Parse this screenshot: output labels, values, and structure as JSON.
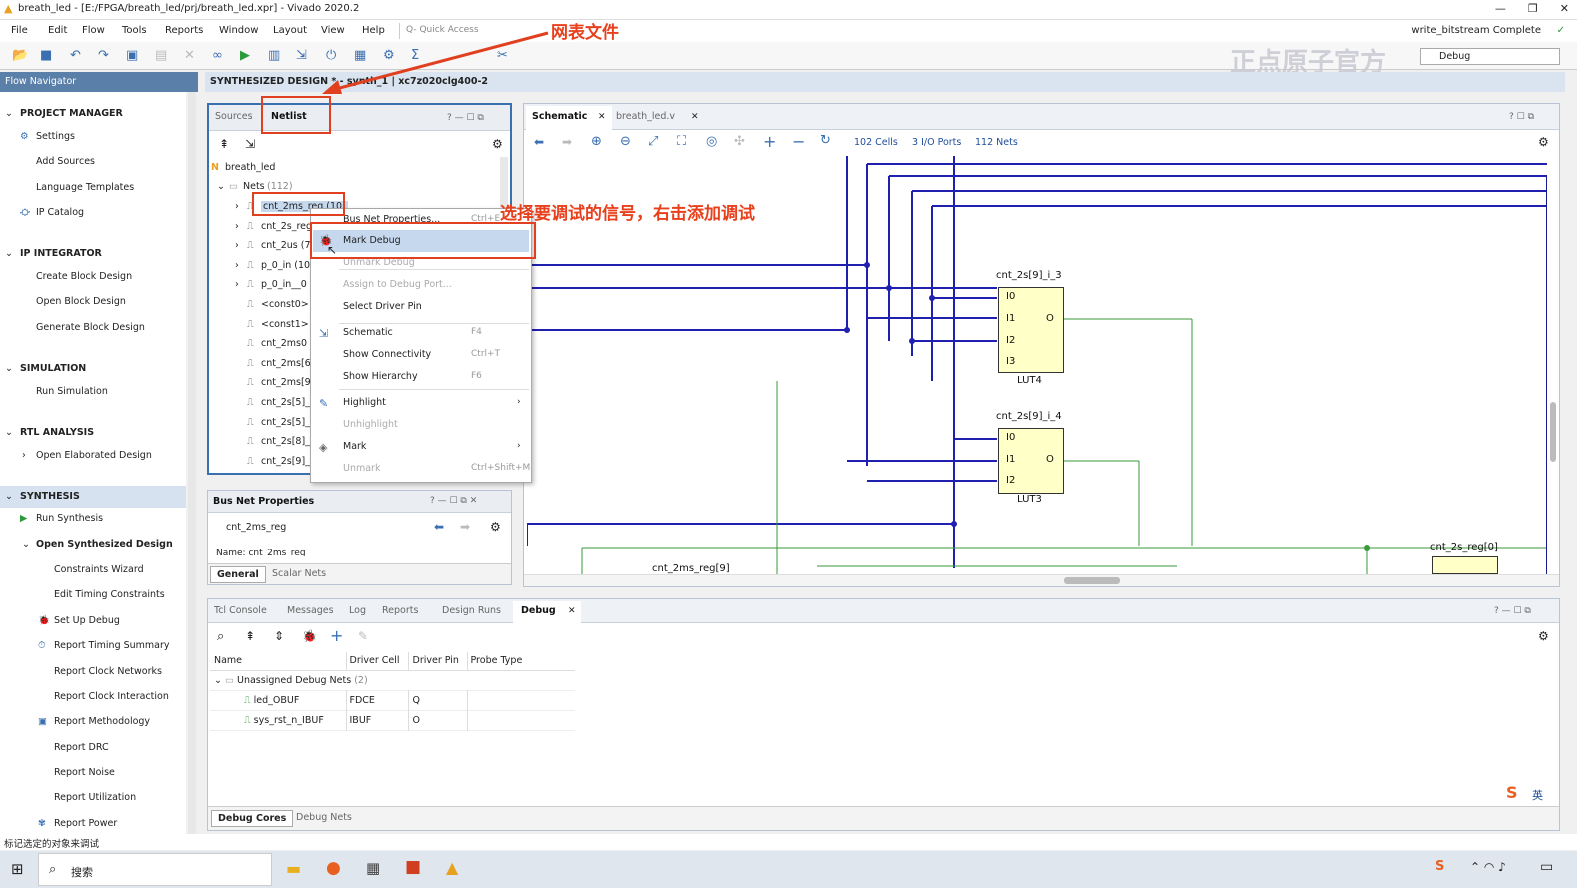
{
  "window": {
    "title": "breath_led - [E:/FPGA/breath_led/prj/breath_led.xpr] - Vivado 2020.2",
    "status_right": "write_bitstream Complete"
  },
  "menu": [
    "File",
    "Edit",
    "Flow",
    "Tools",
    "Reports",
    "Window",
    "Layout",
    "View",
    "Help"
  ],
  "quick_access": {
    "placeholder": "Q- Quick Access"
  },
  "layout_dropdown": "Debug",
  "watermark": "正点原子官方",
  "flow_navigator": {
    "title": "Flow Navigator",
    "items": [
      {
        "label": "PROJECT MANAGER",
        "kind": "section"
      },
      {
        "label": "Settings",
        "kind": "item"
      },
      {
        "label": "Add Sources",
        "kind": "item"
      },
      {
        "label": "Language Templates",
        "kind": "item"
      },
      {
        "label": "IP Catalog",
        "kind": "item"
      },
      {
        "label": "IP INTEGRATOR",
        "kind": "section"
      },
      {
        "label": "Create Block Design",
        "kind": "item"
      },
      {
        "label": "Open Block Design",
        "kind": "item"
      },
      {
        "label": "Generate Block Design",
        "kind": "item"
      },
      {
        "label": "SIMULATION",
        "kind": "section"
      },
      {
        "label": "Run Simulation",
        "kind": "item"
      },
      {
        "label": "RTL ANALYSIS",
        "kind": "section"
      },
      {
        "label": "Open Elaborated Design",
        "kind": "item"
      },
      {
        "label": "SYNTHESIS",
        "kind": "section"
      },
      {
        "label": "Run Synthesis",
        "kind": "item"
      },
      {
        "label": "Open Synthesized Design",
        "kind": "item"
      },
      {
        "label": "Constraints Wizard",
        "kind": "sub"
      },
      {
        "label": "Edit Timing Constraints",
        "kind": "sub"
      },
      {
        "label": "Set Up Debug",
        "kind": "sub"
      },
      {
        "label": "Report Timing Summary",
        "kind": "sub"
      },
      {
        "label": "Report Clock Networks",
        "kind": "sub"
      },
      {
        "label": "Report Clock Interaction",
        "kind": "sub"
      },
      {
        "label": "Report Methodology",
        "kind": "sub"
      },
      {
        "label": "Report DRC",
        "kind": "sub"
      },
      {
        "label": "Report Noise",
        "kind": "sub"
      },
      {
        "label": "Report Utilization",
        "kind": "sub"
      },
      {
        "label": "Report Power",
        "kind": "sub"
      }
    ]
  },
  "design_header": "SYNTHESIZED DESIGN * - synth_1 | xc7z020clg400-2",
  "netlist_panel": {
    "tabs": [
      "Sources",
      "Netlist"
    ],
    "root": "breath_led",
    "nets_label": "Nets",
    "nets_count": "(112)",
    "rows": [
      "cnt_2ms_reg (10)",
      "cnt_2s_reg",
      "cnt_2us (7",
      "p_0_in (10",
      "p_0_in__0",
      "<const0>",
      "<const1>",
      "cnt_2ms0",
      "cnt_2ms[6]",
      "cnt_2ms[9]",
      "cnt_2s[5]_",
      "cnt_2s[5]_i",
      "cnt_2s[8]_i",
      "cnt_2s[9]_"
    ]
  },
  "context_menu": [
    {
      "label": "Bus Net Properties...",
      "shortcut": "Ctrl+E",
      "disabled": false
    },
    {
      "label": "Mark Debug",
      "shortcut": "",
      "disabled": false
    },
    {
      "label": "Unmark Debug",
      "shortcut": "",
      "disabled": true
    },
    {
      "label": "Assign to Debug Port...",
      "shortcut": "",
      "disabled": true
    },
    {
      "label": "Select Driver Pin",
      "shortcut": "",
      "disabled": false
    },
    {
      "label": "Schematic",
      "shortcut": "F4",
      "disabled": false
    },
    {
      "label": "Show Connectivity",
      "shortcut": "Ctrl+T",
      "disabled": false
    },
    {
      "label": "Show Hierarchy",
      "shortcut": "F6",
      "disabled": false
    },
    {
      "label": "Highlight",
      "shortcut": "",
      "disabled": false
    },
    {
      "label": "Unhighlight",
      "shortcut": "",
      "disabled": true
    },
    {
      "label": "Mark",
      "shortcut": "",
      "disabled": false
    },
    {
      "label": "Unmark",
      "shortcut": "Ctrl+Shift+M",
      "disabled": true
    }
  ],
  "annotations": {
    "netlist": "网表文件",
    "select": "选择要调试的信号，右击添加调试"
  },
  "bus_props": {
    "title": "Bus Net Properties",
    "name": "cnt_2ms_reg",
    "partial": "Name:          cnt_2ms_reg",
    "tabs": [
      "General",
      "Scalar Nets"
    ]
  },
  "schematic": {
    "tabs": [
      "Schematic",
      "breath_led.v"
    ],
    "cells": "102 Cells",
    "ports": "3 I/O Ports",
    "nets": "112 Nets",
    "lut_a": {
      "name": "cnt_2s[9]_i_3",
      "type": "LUT4",
      "pins": [
        "I0",
        "I1",
        "I2",
        "I3"
      ],
      "out": "O"
    },
    "lut_b": {
      "name": "cnt_2s[9]_i_4",
      "type": "LUT3",
      "pins": [
        "I0",
        "I1",
        "I2"
      ],
      "out": "O"
    },
    "label_reg0": "cnt_2s_reg[0]",
    "label_reg9": "cnt_2ms_reg[9]"
  },
  "bottom": {
    "tabs": [
      "Tcl Console",
      "Messages",
      "Log",
      "Reports",
      "Design Runs",
      "Debug"
    ],
    "cols": [
      "Name",
      "Driver Cell",
      "Driver Pin",
      "Probe Type"
    ],
    "group": "Unassigned Debug Nets",
    "group_count": "(2)",
    "rows": [
      {
        "name": "led_OBUF",
        "cell": "FDCE",
        "pin": "Q",
        "probe": ""
      },
      {
        "name": "sys_rst_n_IBUF",
        "cell": "IBUF",
        "pin": "O",
        "probe": ""
      }
    ],
    "subtabs": [
      "Debug Cores",
      "Debug Nets"
    ]
  },
  "status_bar": "标记选定的对象来调试",
  "taskbar": {
    "search": "搜索",
    "ime": "英"
  }
}
